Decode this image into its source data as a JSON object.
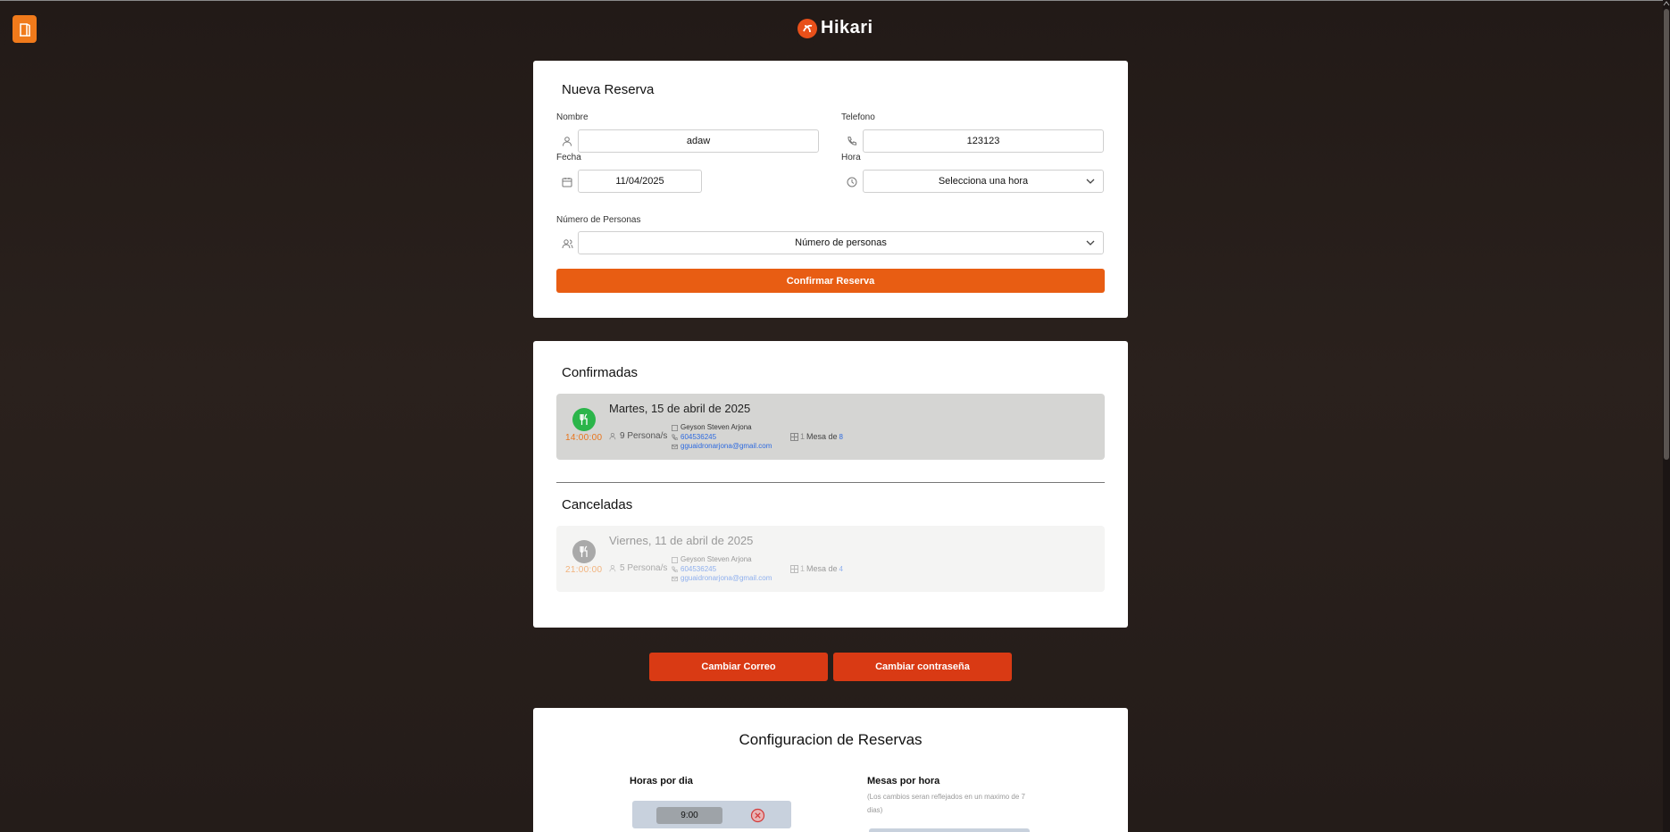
{
  "header": {
    "brand": "Hikari"
  },
  "form": {
    "title": "Nueva Reserva",
    "nombre_label": "Nombre",
    "nombre_value": "adaw",
    "telefono_label": "Telefono",
    "telefono_value": "123123",
    "fecha_label": "Fecha",
    "fecha_value": "11/04/2025",
    "hora_label": "Hora",
    "hora_value": "Selecciona una hora",
    "personas_label": "Número de Personas",
    "personas_value": "Número de personas",
    "submit_label": "Confirmar Reserva"
  },
  "reservas": {
    "confirmed_title": "Confirmadas",
    "cancelled_title": "Canceladas",
    "confirmed": [
      {
        "date": "Martes, 15 de abril de 2025",
        "time": "14:00:00",
        "people": "9 Persona/s",
        "name": "Geyson Steven Arjona",
        "phone": "604536245",
        "email": "gguaidronarjona@gmail.com",
        "table_count": "1",
        "table_text": "Mesa de",
        "table_size": "8"
      }
    ],
    "cancelled": [
      {
        "date": "Viernes, 11 de abril de 2025",
        "time": "21:00:00",
        "people": "5 Persona/s",
        "name": "Geyson Steven Arjona",
        "phone": "604536245",
        "email": "gguaidronarjona@gmail.com",
        "table_count": "1",
        "table_text": "Mesa de",
        "table_size": "4"
      }
    ]
  },
  "account": {
    "change_email_label": "Cambiar Correo",
    "change_password_label": "Cambiar contraseña"
  },
  "config": {
    "title": "Configuracion de Reservas",
    "hours_title": "Horas por dia",
    "tables_title": "Mesas por hora",
    "tables_note": "(Los cambios seran reflejados en un maximo de 7 dias)",
    "hours": [
      "9:00"
    ]
  },
  "colors": {
    "accent": "#e85d13",
    "danger": "#d93a14",
    "confirmed_icon": "#2bb54a",
    "time_text": "#e8741b",
    "link": "#2d6ae0"
  },
  "icons": [
    "exit-door-icon",
    "user-icon",
    "phone-icon",
    "calendar-icon",
    "clock-icon",
    "users-icon",
    "chevron-down-icon",
    "utensils-icon",
    "table-icon",
    "mail-icon",
    "close-circle-icon"
  ]
}
